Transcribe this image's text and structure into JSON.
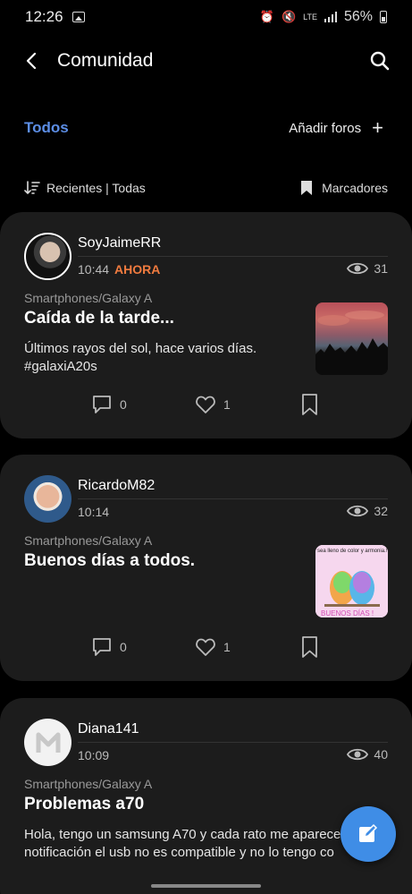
{
  "status_bar": {
    "time": "12:26",
    "network": "LTE",
    "battery": "56%"
  },
  "header": {
    "title": "Comunidad"
  },
  "filters": {
    "active_tab": "Todos",
    "add_forums": "Añadir foros",
    "sort": "Recientes | Todas",
    "bookmarks": "Marcadores"
  },
  "posts": [
    {
      "author": "SoyJaimeRR",
      "time": "10:44",
      "badge": "AHORA",
      "views": "31",
      "category": "Smartphones/Galaxy A",
      "title": "Caída de la tarde...",
      "body": "Últimos rayos del sol, hace varios días. #galaxiA20s",
      "comments": "0",
      "likes": "1"
    },
    {
      "author": "RicardoM82",
      "time": "10:14",
      "views": "32",
      "category": "Smartphones/Galaxy A",
      "title": "Buenos días a todos.",
      "body": "",
      "thumb_text_top": "sea lleno de color y armonia.!",
      "thumb_text_bottom": "BUENOS DÍAS !",
      "comments": "0",
      "likes": "1"
    },
    {
      "author": "Diana141",
      "time": "10:09",
      "views": "40",
      "category": "Smartphones/Galaxy A",
      "title": "Problemas a70",
      "body_line1": "Hola, tengo un samsung A70 y cada rato me aparece",
      "body_line2": "notificación el usb no es compatible y no lo tengo co",
      "comments": "",
      "likes": ""
    }
  ],
  "colors": {
    "accent": "#5c8ee6",
    "badge": "#f07b3f",
    "fab": "#3f8de6",
    "card": "#1c1c1c"
  }
}
